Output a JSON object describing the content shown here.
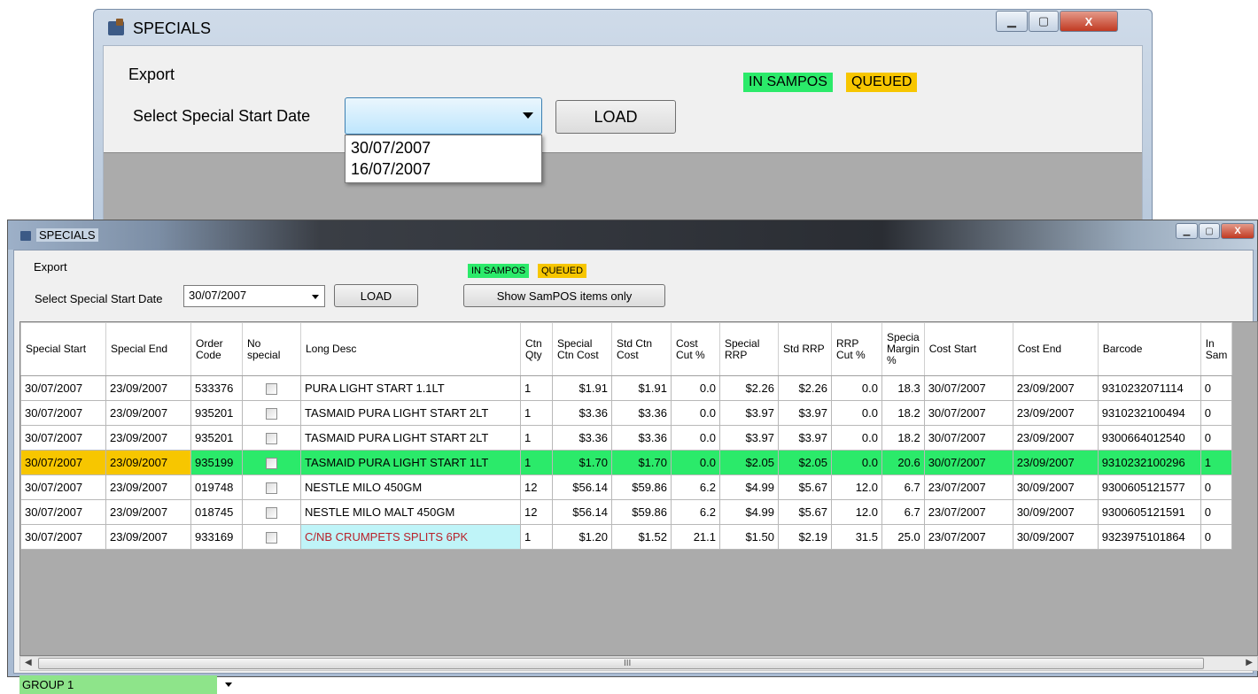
{
  "back_window": {
    "title": "SPECIALS",
    "menu_export": "Export",
    "label_start_date": "Select Special Start Date",
    "combo_value": "",
    "dropdown_options": [
      "30/07/2007",
      "16/07/2007"
    ],
    "load_label": "LOAD",
    "legend_in_sampos": "IN SAMPOS",
    "legend_queued": "QUEUED",
    "caption_minimize": "▁",
    "caption_maximize": "▢",
    "caption_close": "X"
  },
  "front_window": {
    "title": "SPECIALS",
    "menu_export": "Export",
    "label_start_date": "Select Special Start Date",
    "combo_value": "30/07/2007",
    "load_label": "LOAD",
    "show_sampos_label": "Show SamPOS items only",
    "legend_in_sampos": "IN SAMPOS",
    "legend_queued": "QUEUED",
    "scroll_grip": "III",
    "group_value": "GROUP 1"
  },
  "colors": {
    "in_sampos": "#2bea6a",
    "queued": "#f7c600",
    "desc_highlight_bg": "#bff4f8",
    "desc_highlight_text": "#b8222b"
  },
  "grid": {
    "columns": [
      "Special Start",
      "Special End",
      "Order Code",
      "No special",
      "Long Desc",
      "Ctn Qty",
      "Special Ctn Cost",
      "Std Ctn Cost",
      "Cost Cut %",
      "Special RRP",
      "Std RRP",
      "RRP Cut %",
      "Specia Margin %",
      "Cost Start",
      "Cost End",
      "Barcode",
      "In Sam"
    ],
    "rows": [
      {
        "start": "30/07/2007",
        "end": "23/09/2007",
        "code": "533376",
        "desc": "PURA LIGHT START 1.1LT",
        "qty": "1",
        "sp_cost": "$1.91",
        "std_cost": "$1.91",
        "cost_cut": "0.0",
        "sp_rrp": "$2.26",
        "std_rrp": "$2.26",
        "rrp_cut": "0.0",
        "margin": "18.3",
        "cost_start": "30/07/2007",
        "cost_end": "23/09/2007",
        "barcode": "9310232071114",
        "in_sam": "0"
      },
      {
        "start": "30/07/2007",
        "end": "23/09/2007",
        "code": "935201",
        "desc": "TASMAID PURA LIGHT START 2LT",
        "qty": "1",
        "sp_cost": "$3.36",
        "std_cost": "$3.36",
        "cost_cut": "0.0",
        "sp_rrp": "$3.97",
        "std_rrp": "$3.97",
        "rrp_cut": "0.0",
        "margin": "18.2",
        "cost_start": "30/07/2007",
        "cost_end": "23/09/2007",
        "barcode": "9310232100494",
        "in_sam": "0"
      },
      {
        "start": "30/07/2007",
        "end": "23/09/2007",
        "code": "935201",
        "desc": "TASMAID PURA LIGHT START 2LT",
        "qty": "1",
        "sp_cost": "$3.36",
        "std_cost": "$3.36",
        "cost_cut": "0.0",
        "sp_rrp": "$3.97",
        "std_rrp": "$3.97",
        "rrp_cut": "0.0",
        "margin": "18.2",
        "cost_start": "30/07/2007",
        "cost_end": "23/09/2007",
        "barcode": "9300664012540",
        "in_sam": "0"
      },
      {
        "start": "30/07/2007",
        "end": "23/09/2007",
        "code": "935199",
        "desc": "TASMAID PURA LIGHT START 1LT",
        "qty": "1",
        "sp_cost": "$1.70",
        "std_cost": "$1.70",
        "cost_cut": "0.0",
        "sp_rrp": "$2.05",
        "std_rrp": "$2.05",
        "rrp_cut": "0.0",
        "margin": "20.6",
        "cost_start": "30/07/2007",
        "cost_end": "23/09/2007",
        "barcode": "9310232100296",
        "in_sam": "1"
      },
      {
        "start": "30/07/2007",
        "end": "23/09/2007",
        "code": "019748",
        "desc": "NESTLE MILO 450GM",
        "qty": "12",
        "sp_cost": "$56.14",
        "std_cost": "$59.86",
        "cost_cut": "6.2",
        "sp_rrp": "$4.99",
        "std_rrp": "$5.67",
        "rrp_cut": "12.0",
        "margin": "6.7",
        "cost_start": "23/07/2007",
        "cost_end": "30/09/2007",
        "barcode": "9300605121577",
        "in_sam": "0"
      },
      {
        "start": "30/07/2007",
        "end": "23/09/2007",
        "code": "018745",
        "desc": "NESTLE MILO MALT 450GM",
        "qty": "12",
        "sp_cost": "$56.14",
        "std_cost": "$59.86",
        "cost_cut": "6.2",
        "sp_rrp": "$4.99",
        "std_rrp": "$5.67",
        "rrp_cut": "12.0",
        "margin": "6.7",
        "cost_start": "23/07/2007",
        "cost_end": "30/09/2007",
        "barcode": "9300605121591",
        "in_sam": "0"
      },
      {
        "start": "30/07/2007",
        "end": "23/09/2007",
        "code": "933169",
        "desc": "C/NB CRUMPETS SPLITS 6PK",
        "qty": "1",
        "sp_cost": "$1.20",
        "std_cost": "$1.52",
        "cost_cut": "21.1",
        "sp_rrp": "$1.50",
        "std_rrp": "$2.19",
        "rrp_cut": "31.5",
        "margin": "25.0",
        "cost_start": "23/07/2007",
        "cost_end": "30/09/2007",
        "barcode": "9323975101864",
        "in_sam": "0"
      }
    ]
  }
}
